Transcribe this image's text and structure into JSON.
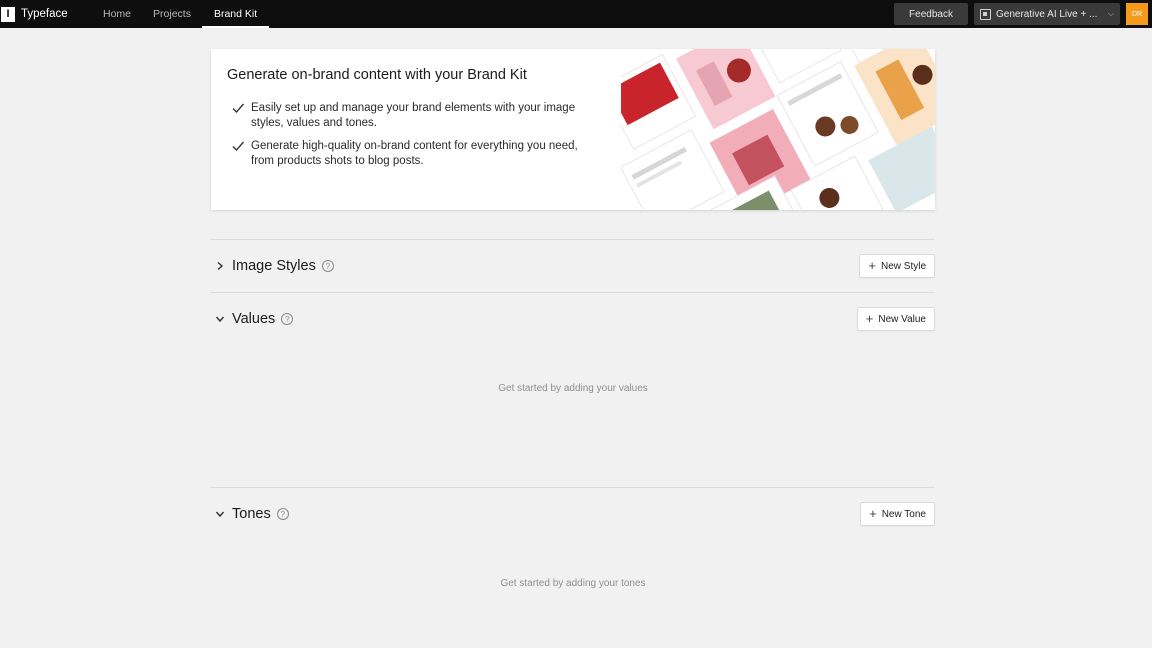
{
  "app": {
    "logo_letter": "I",
    "name": "Typeface"
  },
  "nav": {
    "items": [
      "Home",
      "Projects",
      "Brand Kit"
    ],
    "active": "Brand Kit"
  },
  "header_right": {
    "feedback_label": "Feedback",
    "project_name": "Generative AI Live + ...",
    "avatar_initials": "DR"
  },
  "banner": {
    "title": "Generate on-brand content with your Brand Kit",
    "bullets": [
      "Easily set up and manage your brand elements with your image styles, values and tones.",
      "Generate high-quality on-brand content for everything you need, from products shots to blog posts."
    ]
  },
  "sections": {
    "image_styles": {
      "title": "Image Styles",
      "button_label": "New Style",
      "expanded": false
    },
    "values": {
      "title": "Values",
      "button_label": "New Value",
      "expanded": true,
      "empty_text": "Get started by adding your values"
    },
    "tones": {
      "title": "Tones",
      "button_label": "New Tone",
      "expanded": true,
      "empty_text": "Get started by adding your tones"
    }
  },
  "colors": {
    "topbar": "#0e0e0e",
    "accent": "#f59b1b",
    "background": "#f1f1f1"
  }
}
